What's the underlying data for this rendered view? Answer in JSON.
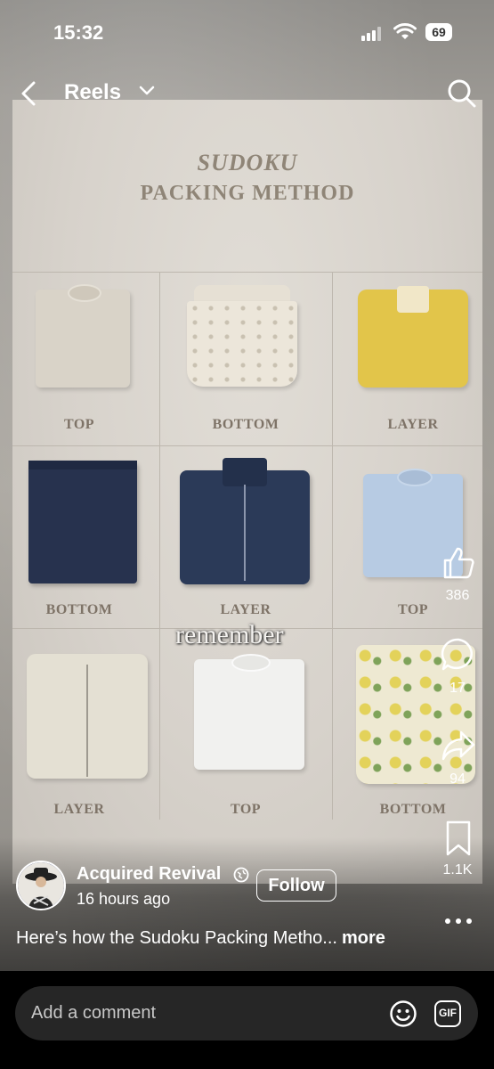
{
  "status_bar": {
    "time": "15:32",
    "battery": "69"
  },
  "nav": {
    "title": "Reels"
  },
  "video": {
    "title_line1": "SUDOKU",
    "title_line2": "PACKING METHOD",
    "overlay_text": "remember",
    "grid": [
      {
        "label": "TOP",
        "color": "#d9d3c8"
      },
      {
        "label": "BOTTOM",
        "color": "#ece6da"
      },
      {
        "label": "LAYER",
        "color": "#e2c54a"
      },
      {
        "label": "BOTTOM",
        "color": "#27324e"
      },
      {
        "label": "LAYER",
        "color": "#2b3a58"
      },
      {
        "label": "TOP",
        "color": "#b7cbe3"
      },
      {
        "label": "LAYER",
        "color": "#e4e0d3"
      },
      {
        "label": "TOP",
        "color": "#f1f1ef"
      },
      {
        "label": "BOTTOM",
        "color": "#eee9d2"
      }
    ]
  },
  "actions": {
    "likes": "386",
    "comments": "17",
    "shares": "94",
    "saves": "1.1K"
  },
  "post": {
    "username": "Acquired Revival",
    "time_ago": "16 hours ago",
    "follow_label": "Follow",
    "caption": "Here’s how the Sudoku Packing Metho...",
    "more_label": "more"
  },
  "comment": {
    "placeholder": "Add a comment",
    "gif_label": "GIF"
  },
  "colors": {
    "comment_bar": "#262626",
    "background": "#000000"
  }
}
